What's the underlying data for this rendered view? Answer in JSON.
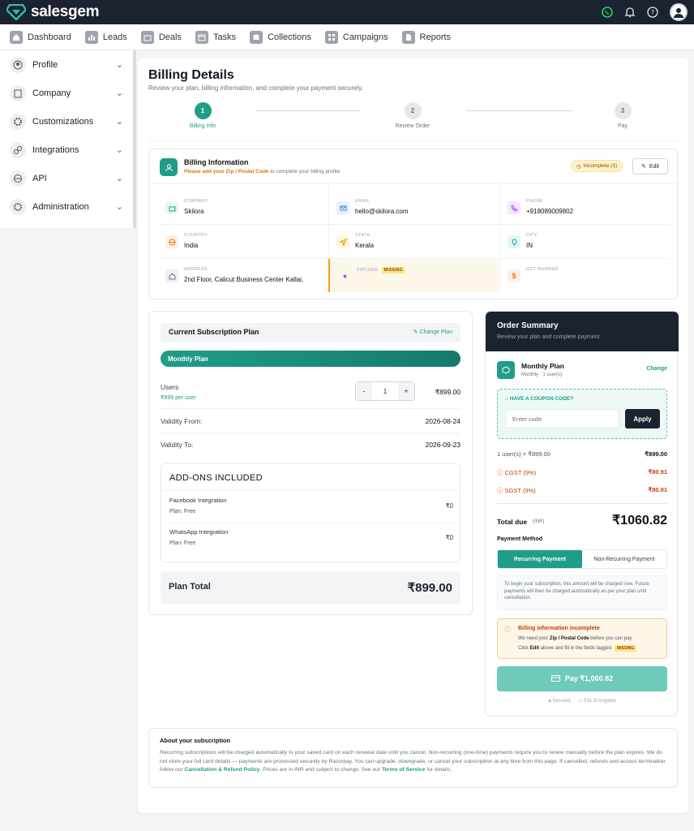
{
  "app": {
    "name": "salesgem"
  },
  "nav": [
    {
      "label": "Dashboard",
      "icon": "home-icon"
    },
    {
      "label": "Leads",
      "icon": "chart-icon"
    },
    {
      "label": "Deals",
      "icon": "briefcase-icon"
    },
    {
      "label": "Tasks",
      "icon": "calendar-icon"
    },
    {
      "label": "Collections",
      "icon": "database-icon"
    },
    {
      "label": "Campaigns",
      "icon": "grid-icon"
    },
    {
      "label": "Reports",
      "icon": "document-icon"
    }
  ],
  "sidebar": [
    {
      "label": "Profile",
      "icon": "user-icon"
    },
    {
      "label": "Company",
      "icon": "building-icon"
    },
    {
      "label": "Customizations",
      "icon": "settings-icon"
    },
    {
      "label": "Integrations",
      "icon": "link-icon"
    },
    {
      "label": "API",
      "icon": "api-icon"
    },
    {
      "label": "Administration",
      "icon": "admin-icon"
    }
  ],
  "page": {
    "title": "Billing Details",
    "subtitle": "Review your plan, billing information, and complete your payment securely."
  },
  "steps": [
    {
      "num": "1",
      "label": "Billing Info",
      "active": true
    },
    {
      "num": "2",
      "label": "Review Order",
      "active": false
    },
    {
      "num": "3",
      "label": "Pay",
      "active": false
    }
  ],
  "billing_info": {
    "title": "Billing Information",
    "sub_prefix": "Please add your",
    "sub_field": "Zip / Postal Code",
    "sub_suffix": "to complete your billing profile",
    "status": "Incomplete (1)",
    "edit_label": "Edit",
    "fields": {
      "company": {
        "label": "COMPANY",
        "value": "Skilora"
      },
      "email": {
        "label": "EMAIL",
        "value": "hello@skilora.com"
      },
      "phone": {
        "label": "PHONE",
        "value": "+918089009802"
      },
      "country": {
        "label": "COUNTRY",
        "value": "India"
      },
      "state": {
        "label": "STATE",
        "value": "Kerala"
      },
      "city": {
        "label": "CITY",
        "value": "IN"
      },
      "address": {
        "label": "ADDRESS",
        "value": "2nd Floor, Calicut Business Center Kallai,"
      },
      "zipcode": {
        "label": "ZIPCODE",
        "value": "",
        "badge": "MISSING"
      },
      "gst": {
        "label": "GST NUMBER",
        "value": ""
      }
    }
  },
  "plan": {
    "header": "Current Subscription Plan",
    "change_label": "Change Plan",
    "name": "Monthly Plan",
    "users_label": "Users",
    "per_user": "₹899 per user",
    "minus": "-",
    "qty": "1",
    "plus": "+",
    "users_total": "₹899.00",
    "validity_from_label": "Validity From:",
    "validity_from": "2026-08-24",
    "validity_to_label": "Validity To:",
    "validity_to": "2026-09-23",
    "addons_title": "ADD-ONS INCLUDED",
    "addons": [
      {
        "name": "Facebook Integration",
        "plan": "Plan: Free",
        "price": "₹0"
      },
      {
        "name": "WhatsApp Integration",
        "plan": "Plan: Free",
        "price": "₹0"
      }
    ],
    "total_label": "Plan Total",
    "total": "₹899.00"
  },
  "order": {
    "title": "Order Summary",
    "subtitle": "Review your plan and complete payment",
    "plan_name": "Monthly Plan",
    "plan_meta": "Monthly · 1 user(s)",
    "change_label": "Change",
    "coupon_title": "HAVE A COUPON CODE?",
    "coupon_placeholder": "Enter code",
    "apply_label": "Apply",
    "line_label": "1 user(s) × ₹899.00",
    "line_value": "₹899.00",
    "cgst_label": "CGST (9%)",
    "cgst_value": "₹80.91",
    "sgst_label": "SGST (9%)",
    "sgst_value": "₹80.91",
    "total_label": "Total due",
    "total_currency": "(INR)",
    "total_value": "₹1060.82",
    "payment_method_label": "Payment Method",
    "recurring_label": "Recurring Payment",
    "nonrecurring_label": "Non-Recurring Payment",
    "info_text": "To begin your subscription, this amount will be charged now. Future payments will then be charged automatically as per your plan until cancellation.",
    "warn_title": "Billing information incomplete",
    "warn_line1_a": "We need your",
    "warn_line1_b": "Zip / Postal Code",
    "warn_line1_c": "before you can pay.",
    "warn_line2_a": "Click",
    "warn_line2_b": "Edit",
    "warn_line2_c": "above and fill in the fields tagged",
    "warn_badge": "MISSING",
    "pay_label": "Pay ₹1,060.82",
    "secured": "Secured",
    "ssl": "SSL Encrypted"
  },
  "about": {
    "title": "About your subscription",
    "text_a": "Recurring subscriptions will be charged automatically to your saved card on each renewal date until you cancel. Non-recurring (one-time) payments require you to renew manually before the plan expires. We do not store your full card details — payments are processed securely by Razorpay. You can upgrade, downgrade, or cancel your subscription at any time from this page. If cancelled, refunds and access termination follow our",
    "link1": "Cancellation & Refund Policy",
    "text_b": ". Prices are in INR and subject to change. See our",
    "link2": "Terms of Service",
    "text_c": "for details."
  },
  "colors": {
    "accent": "#1f9d88",
    "dark": "#1b2230",
    "warning": "#d97706"
  }
}
